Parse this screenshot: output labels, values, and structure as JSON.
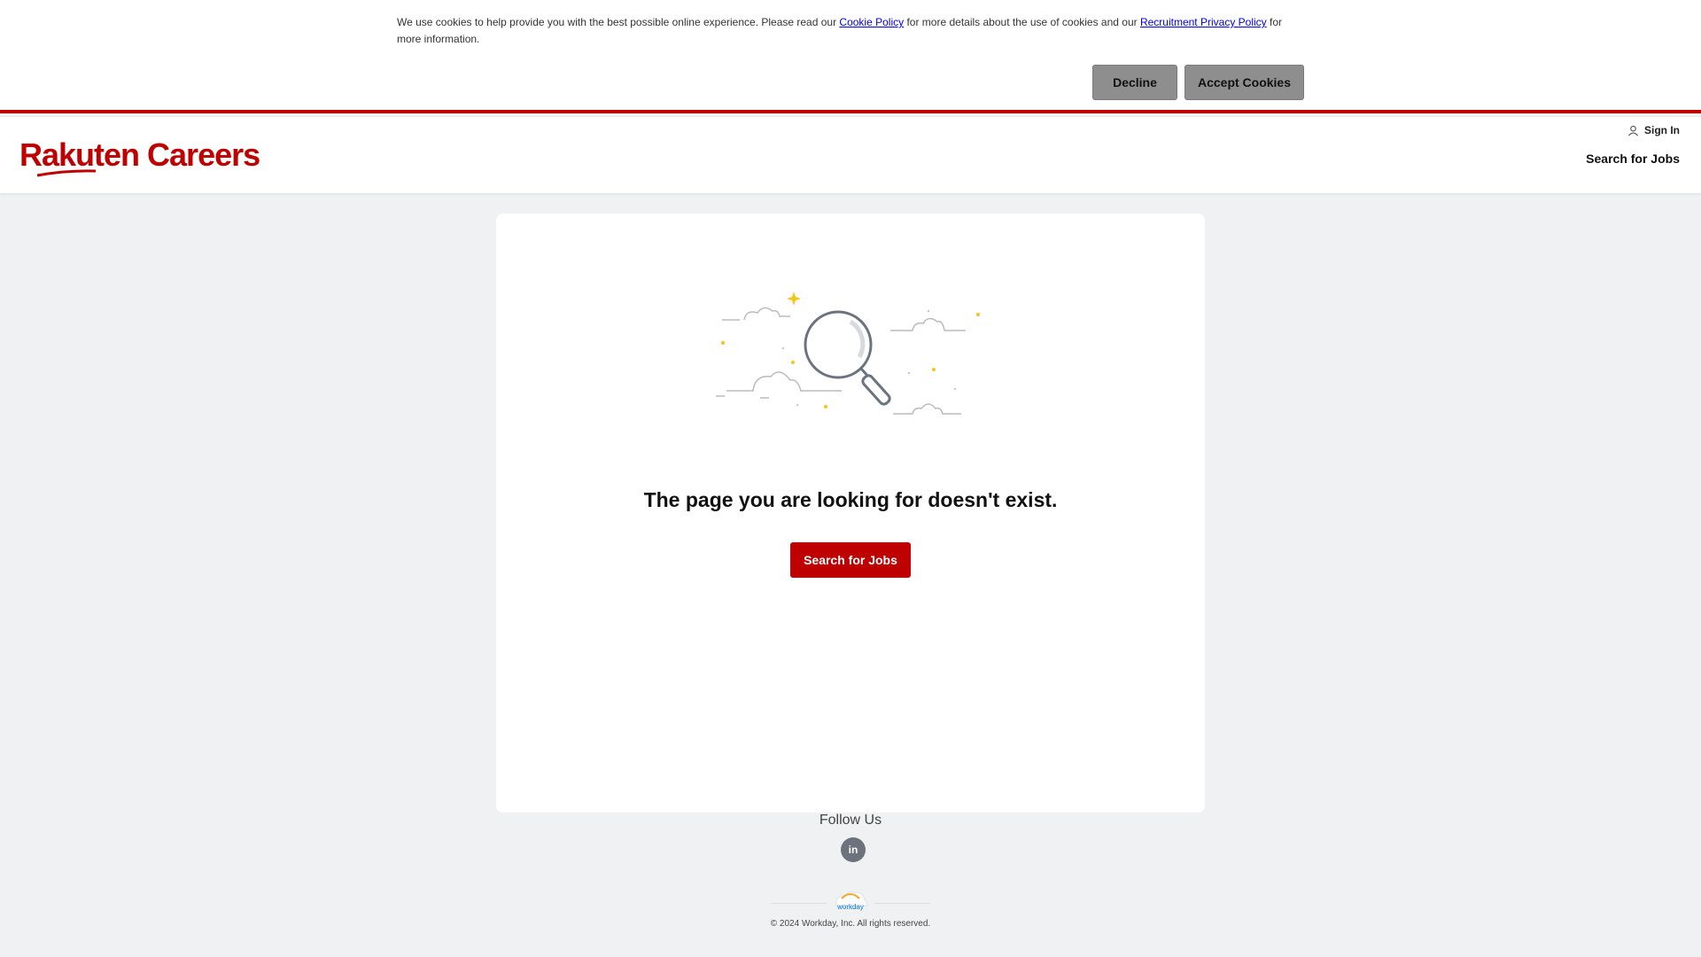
{
  "cookie_banner": {
    "text_before": "We use cookies to help provide you with the best possible online experience. Please read our ",
    "cookie_policy_link": "Cookie Policy",
    "text_middle": " for more details about the use of cookies and our ",
    "privacy_policy_link": "Recruitment Privacy Policy",
    "text_after": " for more information.",
    "decline_label": "Decline",
    "accept_label": "Accept Cookies"
  },
  "header": {
    "logo_text": "Rakuten Careers",
    "sign_in_label": "Sign In",
    "search_jobs_label": "Search for Jobs"
  },
  "main": {
    "headline": "The page you are looking for doesn't exist.",
    "search_button_label": "Search for Jobs",
    "illustration_icon": "magnifying-glass-icon"
  },
  "footer": {
    "follow_label": "Follow Us",
    "linkedin_label": "in",
    "workday_label": "workday",
    "copyright": "© 2024 Workday, Inc. All rights reserved."
  },
  "colors": {
    "brand_red": "#bf0000",
    "page_bg": "#f0f1f2",
    "button_grey": "#8e8e8e"
  }
}
